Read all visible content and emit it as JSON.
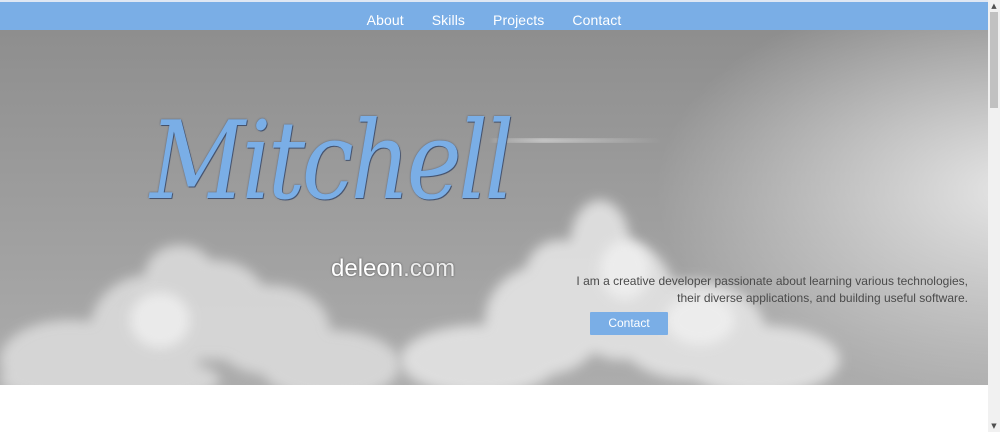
{
  "nav": {
    "items": [
      {
        "label": "About"
      },
      {
        "label": "Skills"
      },
      {
        "label": "Projects"
      },
      {
        "label": "Contact"
      }
    ]
  },
  "hero": {
    "logo_script": "Mitchell",
    "logo_name": "deleon",
    "logo_tld": ".com",
    "tagline_line1": "I am a creative developer passionate about learning various technologies,",
    "tagline_line2": "their diverse applications, and building useful software.",
    "cta_label": "Contact"
  },
  "colors": {
    "accent": "#7aaee6",
    "hero_bg": "#9c9c9c",
    "page_bg": "#ffffff"
  },
  "icons": {
    "scroll_up": "chevron-up-icon",
    "scroll_down": "chevron-down-icon"
  },
  "scrollbar_glyphs": {
    "up": "▲",
    "down": "▼"
  }
}
